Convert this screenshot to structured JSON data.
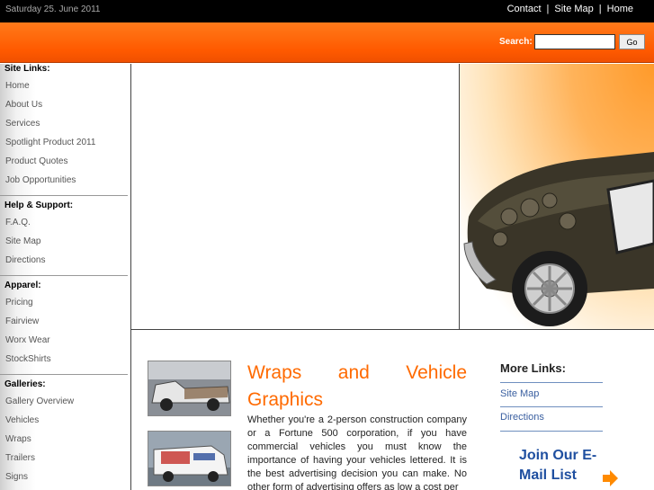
{
  "header": {
    "date": "Saturday 25. June 2011",
    "links": [
      "Contact",
      "Site Map",
      "Home"
    ],
    "separator": "|"
  },
  "search": {
    "label": "Search:",
    "value": "",
    "button": "Go"
  },
  "sidebar": {
    "sections": [
      {
        "title": "Site Links:",
        "items": [
          "Home",
          "About Us",
          "Services",
          "Spotlight Product 2011",
          "Product Quotes",
          "Job Opportunities"
        ]
      },
      {
        "title": "Help & Support:",
        "items": [
          "F.A.Q.",
          "Site Map",
          "Directions"
        ]
      },
      {
        "title": "Apparel:",
        "items": [
          "Pricing",
          "Fairview",
          "Worx Wear",
          "StockShirts"
        ]
      },
      {
        "title": "Galleries:",
        "items": [
          "Gallery Overview",
          "Vehicles",
          "Wraps",
          "Trailers",
          "Signs"
        ]
      }
    ]
  },
  "article": {
    "title_line1": "Wraps and Vehicle",
    "title_line2": "Graphics",
    "body": "Whether you're a 2-person construction company or a Fortune 500 corporation, if you have commercial vehicles you must know the importance of having your vehicles lettered. It is the best advertising decision you can make. No other form of advertising offers as low a cost per"
  },
  "more_links": {
    "title": "More Links:",
    "items": [
      "Site Map",
      "Directions"
    ],
    "join": "Join Our E-Mail List"
  },
  "colors": {
    "accent": "#ff6a00",
    "link": "#3a5fa0",
    "join": "#1f4fa0"
  }
}
